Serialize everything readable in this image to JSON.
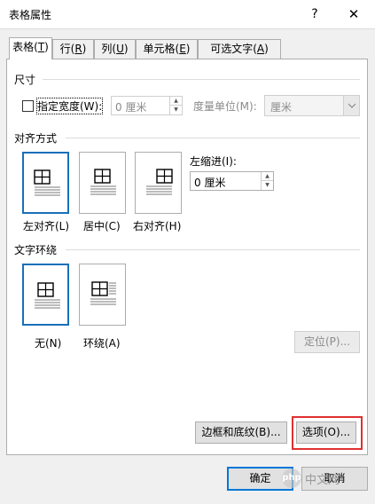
{
  "window": {
    "title": "表格属性",
    "help_glyph": "?",
    "close_glyph": "✕"
  },
  "tabs": [
    {
      "label": "表格(",
      "key": "T",
      "suffix": ")",
      "active": true
    },
    {
      "label": "行(",
      "key": "R",
      "suffix": ")",
      "active": false
    },
    {
      "label": "列(",
      "key": "U",
      "suffix": ")",
      "active": false
    },
    {
      "label": "单元格(",
      "key": "E",
      "suffix": ")",
      "active": false
    },
    {
      "label": "可选文字(",
      "key": "A",
      "suffix": ")",
      "active": false
    }
  ],
  "size": {
    "title": "尺寸",
    "width_checkbox_label": "指定宽度(W):",
    "width_checked": false,
    "width_value": "0 厘米",
    "unit_label": "度量单位(M):",
    "unit_value": "厘米"
  },
  "alignment": {
    "title": "对齐方式",
    "options": [
      {
        "label": "左对齐(L)",
        "selected": true
      },
      {
        "label": "居中(C)",
        "selected": false
      },
      {
        "label": "右对齐(H)",
        "selected": false
      }
    ],
    "indent_label": "左缩进(I):",
    "indent_value": "0 厘米"
  },
  "wrapping": {
    "title": "文字环绕",
    "options": [
      {
        "label": "无(N)",
        "selected": true
      },
      {
        "label": "环绕(A)",
        "selected": false
      }
    ],
    "position_button": "定位(P)..."
  },
  "buttons": {
    "borders": "边框和底纹(B)...",
    "options": "选项(O)...",
    "ok": "确定",
    "cancel": "取消"
  },
  "watermark": {
    "logo": "php",
    "text": "中文网"
  },
  "colors": {
    "selection_blue": "#1a6fba",
    "highlight_red": "#e03030",
    "default_button_border": "#0078d7"
  }
}
